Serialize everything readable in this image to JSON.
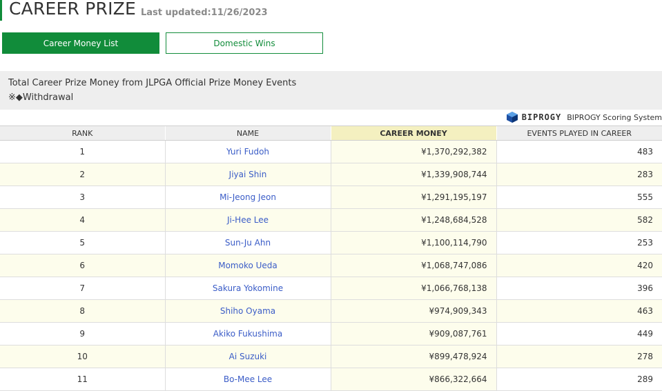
{
  "header": {
    "title": "CAREER PRIZE",
    "last_updated": "Last updated:11/26/2023"
  },
  "tabs": [
    {
      "label": "Career Money List",
      "active": true
    },
    {
      "label": "Domestic Wins",
      "active": false
    }
  ],
  "info": {
    "description": "Total Career Prize Money from JLPGA Official Prize Money Events",
    "note": "※◆Withdrawal"
  },
  "sponsor": {
    "logo_text": "BIPROGY",
    "label": "BIPROGY Scoring System",
    "logo_icon": "biprogy-logo-icon"
  },
  "colors": {
    "accent_green": "#118c3a",
    "link_blue": "#3a5cc7",
    "highlight_yellow": "#fdfdec"
  },
  "table": {
    "headers": {
      "rank": "RANK",
      "name": "NAME",
      "money": "CAREER MONEY",
      "events": "EVENTS PLAYED IN CAREER"
    },
    "rows": [
      {
        "rank": "1",
        "name": "Yuri Fudoh",
        "money": "¥1,370,292,382",
        "events": "483"
      },
      {
        "rank": "2",
        "name": "Jiyai Shin",
        "money": "¥1,339,908,744",
        "events": "283"
      },
      {
        "rank": "3",
        "name": "Mi-Jeong Jeon",
        "money": "¥1,291,195,197",
        "events": "555"
      },
      {
        "rank": "4",
        "name": "Ji-Hee Lee",
        "money": "¥1,248,684,528",
        "events": "582"
      },
      {
        "rank": "5",
        "name": "Sun-Ju Ahn",
        "money": "¥1,100,114,790",
        "events": "253"
      },
      {
        "rank": "6",
        "name": "Momoko Ueda",
        "money": "¥1,068,747,086",
        "events": "420"
      },
      {
        "rank": "7",
        "name": "Sakura Yokomine",
        "money": "¥1,066,768,138",
        "events": "396"
      },
      {
        "rank": "8",
        "name": "Shiho Oyama",
        "money": "¥974,909,343",
        "events": "463"
      },
      {
        "rank": "9",
        "name": "Akiko Fukushima",
        "money": "¥909,087,761",
        "events": "449"
      },
      {
        "rank": "10",
        "name": "Ai Suzuki",
        "money": "¥899,478,924",
        "events": "278"
      },
      {
        "rank": "11",
        "name": "Bo-Mee Lee",
        "money": "¥866,322,664",
        "events": "289"
      }
    ]
  }
}
